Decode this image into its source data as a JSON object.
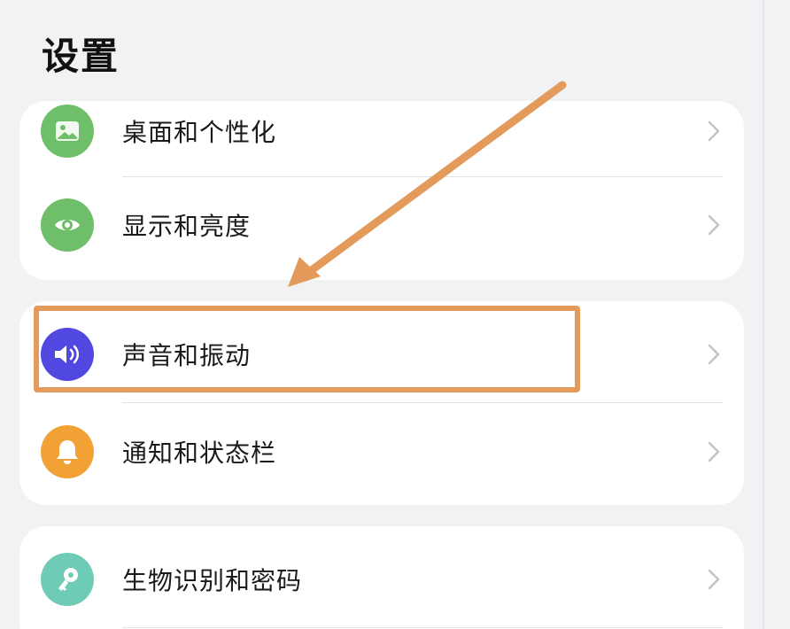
{
  "header": {
    "title": "设置"
  },
  "items": [
    {
      "label": "桌面和个性化",
      "icon": "wallpaper-icon",
      "color": "#6fbf6a"
    },
    {
      "label": "显示和亮度",
      "icon": "eye-icon",
      "color": "#6fbf6a"
    },
    {
      "label": "声音和振动",
      "icon": "volume-icon",
      "color": "#5048e0"
    },
    {
      "label": "通知和状态栏",
      "icon": "bell-icon",
      "color": "#f2a235"
    },
    {
      "label": "生物识别和密码",
      "icon": "key-icon",
      "color": "#6ecbb6"
    }
  ],
  "annotation": {
    "color": "#e39a5b",
    "highlighted_item": "声音和振动"
  },
  "colors": {
    "background": "#f1f2f4",
    "card": "#ffffff",
    "chevron": "#c4c4c8"
  }
}
